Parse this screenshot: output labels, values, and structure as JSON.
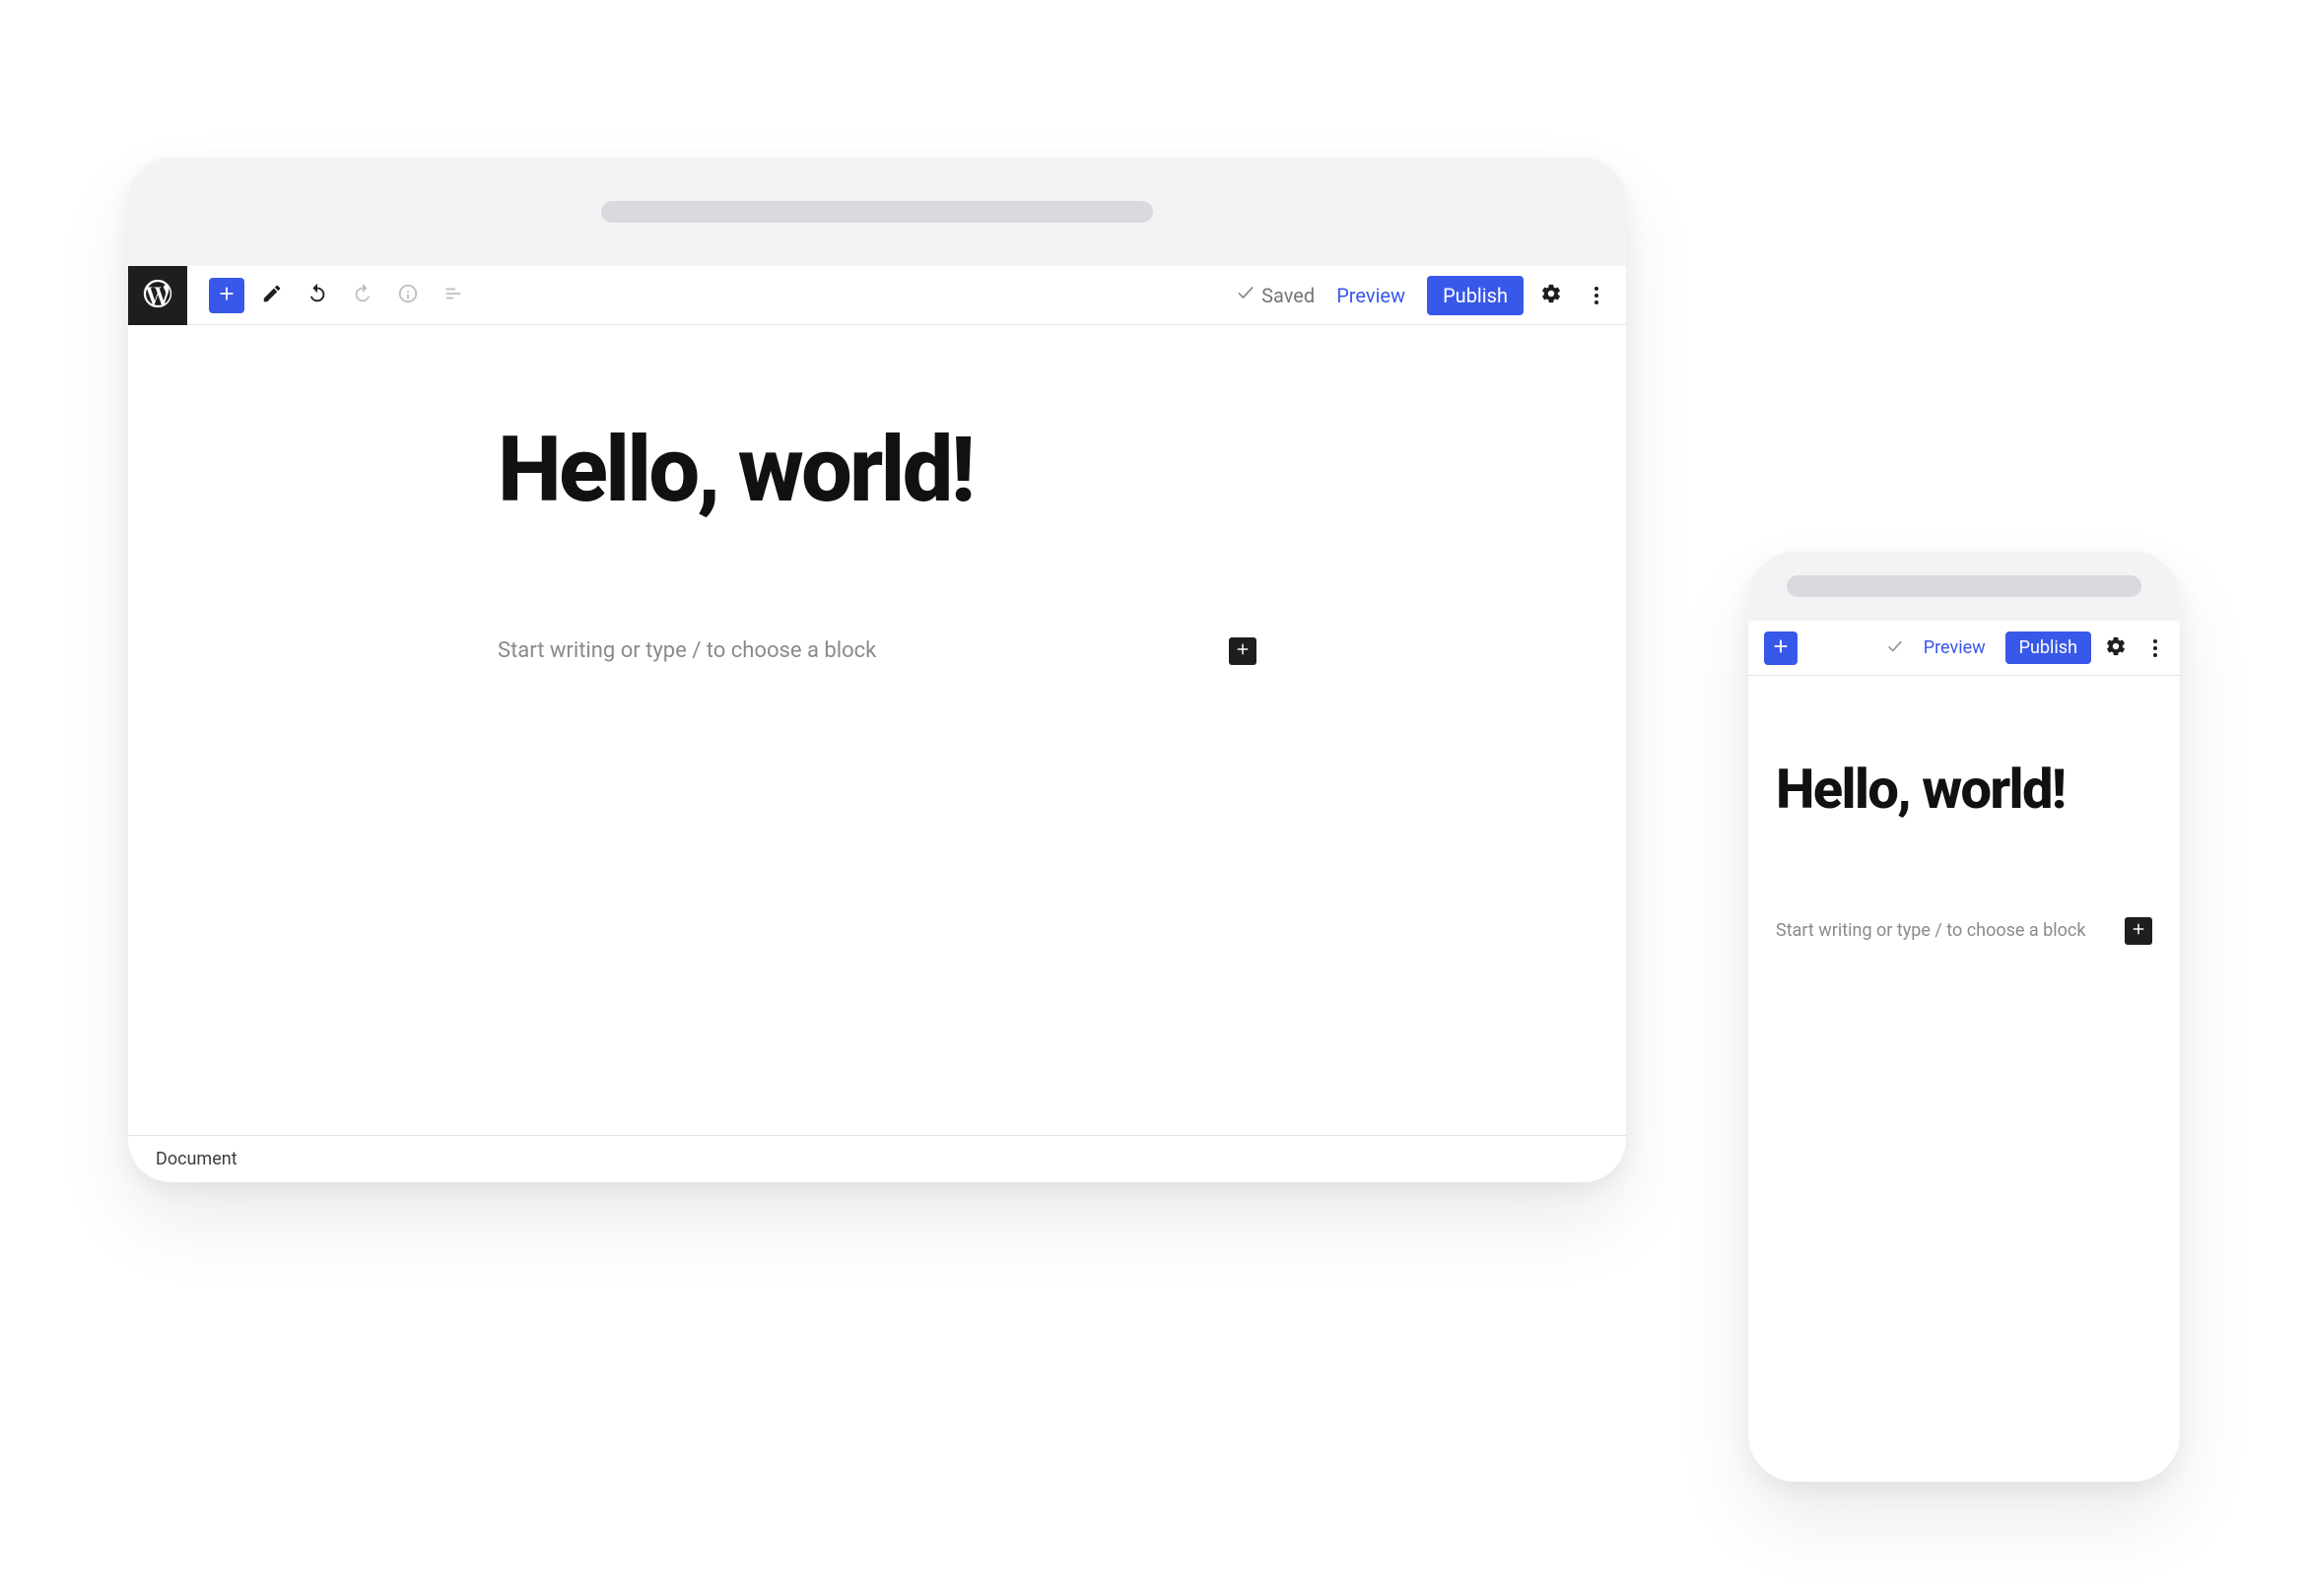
{
  "desktop": {
    "toolbar": {
      "saved_label": "Saved",
      "preview_label": "Preview",
      "publish_label": "Publish"
    },
    "post": {
      "title": "Hello, world!",
      "appender_placeholder": "Start writing or type / to choose a block"
    },
    "footer": {
      "breadcrumb": "Document"
    }
  },
  "mobile": {
    "toolbar": {
      "preview_label": "Preview",
      "publish_label": "Publish"
    },
    "post": {
      "title": "Hello, world!",
      "appender_placeholder": "Start writing or type / to choose a block"
    }
  },
  "icons": {
    "wp_logo": "wordpress-logo-icon",
    "add": "plus-icon",
    "edit": "pencil-icon",
    "undo": "undo-icon",
    "redo": "redo-icon",
    "info": "info-icon",
    "outline": "document-outline-icon",
    "check": "check-icon",
    "gear": "gear-icon",
    "kebab": "more-vertical-icon",
    "appender_add": "plus-icon"
  },
  "colors": {
    "primary": "#3858e9",
    "ink": "#1e1e1e",
    "muted": "#757575"
  }
}
